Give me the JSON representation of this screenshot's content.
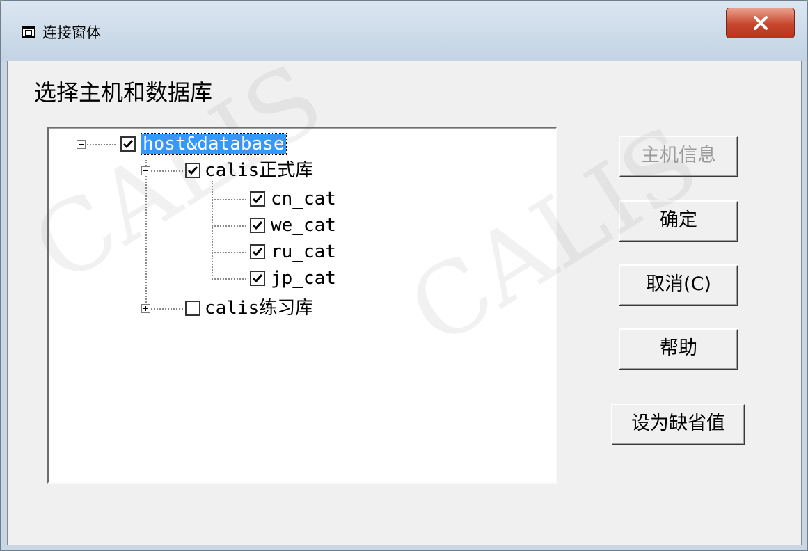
{
  "window": {
    "title": "连接窗体",
    "close_glyph": "X"
  },
  "heading": "选择主机和数据库",
  "tree": {
    "root": {
      "label": "host&database",
      "checked": true,
      "expanded": true,
      "selected": true
    },
    "children": [
      {
        "label": "calis正式库",
        "checked": true,
        "expanded": true,
        "children": [
          {
            "label": "cn_cat",
            "checked": true
          },
          {
            "label": "we_cat",
            "checked": true
          },
          {
            "label": "ru_cat",
            "checked": true
          },
          {
            "label": "jp_cat",
            "checked": true
          }
        ]
      },
      {
        "label": "calis练习库",
        "checked": false,
        "expanded": false
      }
    ]
  },
  "buttons": {
    "host_info": "主机信息",
    "ok": "确定",
    "cancel": "取消(C)",
    "help": "帮助",
    "set_default": "设为缺省值"
  },
  "watermark": "CALIS",
  "colors": {
    "selection": "#3399ff",
    "close": "#c8462c"
  }
}
